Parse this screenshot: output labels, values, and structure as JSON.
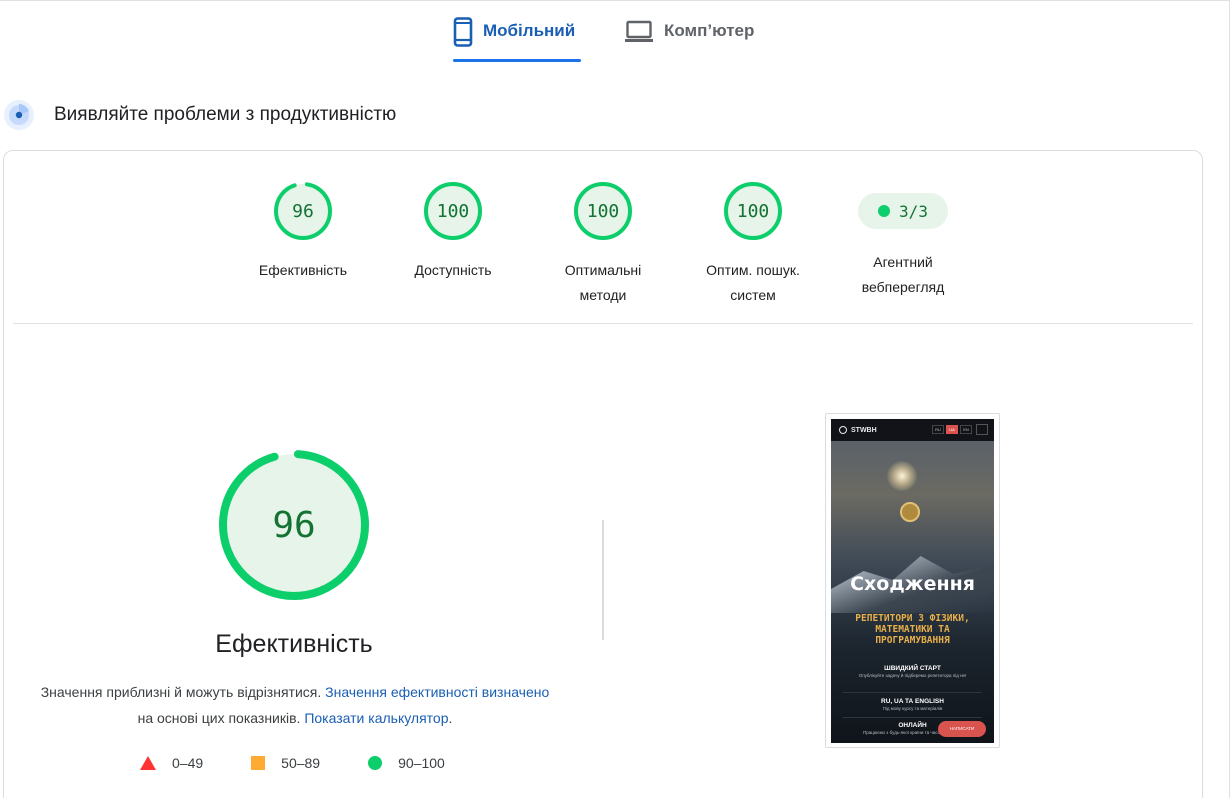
{
  "tabs": {
    "mobile_label": "Мобільний",
    "desktop_label": "Комп’ютер",
    "active": "mobile"
  },
  "section": {
    "title": "Виявляйте проблеми з продуктивністю"
  },
  "categories": [
    {
      "score": "96",
      "label": "Ефективність"
    },
    {
      "score": "100",
      "label": "Доступність"
    },
    {
      "score": "100",
      "label_line1": "Оптимальні",
      "label_line2": "методи"
    },
    {
      "score": "100",
      "label_line1": "Оптим. пошук.",
      "label_line2": "систем"
    }
  ],
  "agentic": {
    "value": "3/3",
    "label_line1": "Агентний",
    "label_line2": "вебперегляд"
  },
  "performance": {
    "score": "96",
    "score_fraction": 0.96,
    "title": "Ефективність",
    "desc_part1": "Значення приблизні й можуть відрізнятися.",
    "desc_link1": "Значення ефективності визначено",
    "desc_part2": "на основі цих показників.",
    "desc_link2": "Показати калькулятор",
    "desc_end": "."
  },
  "legend": [
    {
      "range": "0–49",
      "shape": "triangle",
      "color": "#ff3333"
    },
    {
      "range": "50–89",
      "shape": "square",
      "color": "#ffaa33"
    },
    {
      "range": "90–100",
      "shape": "circle",
      "color": "#0cce6b"
    }
  ],
  "colors": {
    "pass": "#0cce6b",
    "pass_bg": "#e6f4ea",
    "pass_text": "#137333",
    "accent": "#1a73e8"
  },
  "thumbnail": {
    "logo": "STWBH",
    "langs": [
      "RU",
      "UA",
      "EN"
    ],
    "active_lang": "UA",
    "hero_title": "Сходження",
    "hero_subtitle": "РЕПЕТИТОРИ З ФІЗИКИ, МАТЕМАТИКИ ТА ПРОГРАМУВАННЯ",
    "features": [
      {
        "title": "ШВИДКИЙ СТАРТ",
        "text": "Опублікуйте задачу й підберемо репетитора під неї"
      },
      {
        "title": "RU, UA ТА ENGLISH",
        "text": "Під мову курсу та матеріалів"
      },
      {
        "title": "ОНЛАЙН",
        "text": "Працюємо з будь-якої країни та часового поясу"
      }
    ],
    "cta": "НАПИСАТИ"
  }
}
